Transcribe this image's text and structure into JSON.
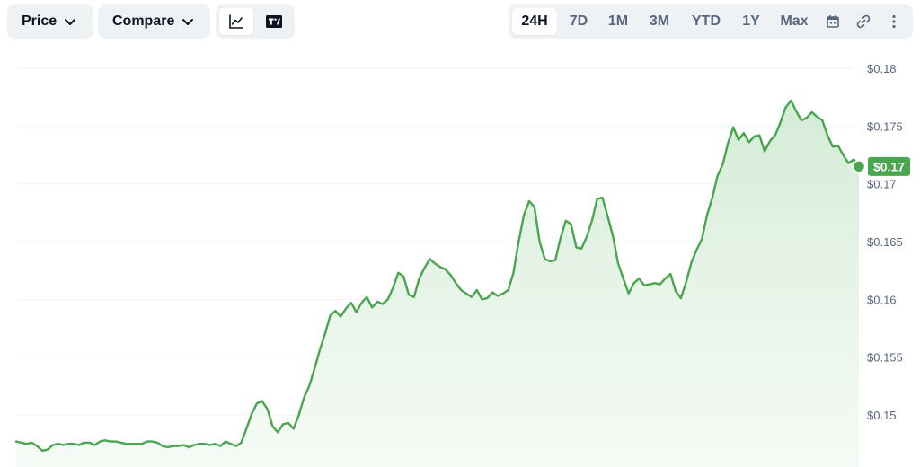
{
  "toolbar": {
    "price_label": "Price",
    "compare_label": "Compare",
    "chart_type_icons": [
      "line-chart-icon",
      "tradingview-icon"
    ],
    "ranges": [
      "24H",
      "7D",
      "1M",
      "3M",
      "YTD",
      "1Y",
      "Max"
    ],
    "active_range": "24H",
    "right_icons": [
      "calendar-icon",
      "link-icon",
      "more-icon"
    ]
  },
  "colors": {
    "line": "#4aa54f",
    "badge": "#4aa54f",
    "area_top": "#d8efd9",
    "grid": "#eff2f5"
  },
  "chart_data": {
    "type": "area",
    "title": "",
    "xlabel": "",
    "ylabel": "",
    "ylim": [
      0.1468,
      0.1805
    ],
    "yticks": [
      0.15,
      0.155,
      0.16,
      0.165,
      0.17,
      0.175,
      0.18
    ],
    "ytick_labels": [
      "$0.15",
      "$0.155",
      "$0.16",
      "$0.165",
      "$0.17",
      "$0.175",
      "$0.18"
    ],
    "current_value_label": "$0.17",
    "series": [
      {
        "values": [
          0.1477,
          0.1476,
          0.1475,
          0.1476,
          0.1473,
          0.1469,
          0.147,
          0.1474,
          0.1475,
          0.1474,
          0.1475,
          0.1475,
          0.1474,
          0.1476,
          0.1476,
          0.1474,
          0.1477,
          0.1478,
          0.1477,
          0.1477,
          0.1476,
          0.1475,
          0.1475,
          0.1475,
          0.1475,
          0.1477,
          0.1477,
          0.1476,
          0.1473,
          0.1472,
          0.1473,
          0.1473,
          0.1474,
          0.1472,
          0.1474,
          0.1475,
          0.1475,
          0.1474,
          0.1475,
          0.1473,
          0.1477,
          0.1475,
          0.1473,
          0.1476,
          0.1488,
          0.1501,
          0.151,
          0.1512,
          0.1505,
          0.149,
          0.1485,
          0.1492,
          0.1493,
          0.1488,
          0.15,
          0.1515,
          0.1525,
          0.154,
          0.1556,
          0.157,
          0.1586,
          0.159,
          0.1585,
          0.1592,
          0.1597,
          0.1589,
          0.1597,
          0.1602,
          0.1593,
          0.1598,
          0.1596,
          0.16,
          0.161,
          0.1623,
          0.162,
          0.1604,
          0.1602,
          0.1618,
          0.1627,
          0.1635,
          0.1631,
          0.1628,
          0.1626,
          0.1621,
          0.1614,
          0.1608,
          0.1605,
          0.1602,
          0.1608,
          0.16,
          0.1601,
          0.1606,
          0.1603,
          0.1605,
          0.1608,
          0.1623,
          0.165,
          0.1673,
          0.1685,
          0.168,
          0.165,
          0.1635,
          0.1633,
          0.1634,
          0.1653,
          0.1668,
          0.1665,
          0.1645,
          0.1644,
          0.1654,
          0.1668,
          0.1687,
          0.1688,
          0.1672,
          0.1655,
          0.1631,
          0.1618,
          0.1605,
          0.1614,
          0.1618,
          0.1612,
          0.1613,
          0.1614,
          0.1613,
          0.1618,
          0.1622,
          0.1607,
          0.1601,
          0.1615,
          0.1632,
          0.1643,
          0.1652,
          0.1673,
          0.1688,
          0.1707,
          0.1717,
          0.1735,
          0.1749,
          0.1738,
          0.1744,
          0.1736,
          0.1741,
          0.1742,
          0.1728,
          0.1737,
          0.1742,
          0.1753,
          0.1766,
          0.1772,
          0.1763,
          0.1755,
          0.1757,
          0.1762,
          0.1758,
          0.1755,
          0.1742,
          0.1732,
          0.1733,
          0.1725,
          0.1718,
          0.1721,
          0.1715
        ]
      }
    ]
  }
}
